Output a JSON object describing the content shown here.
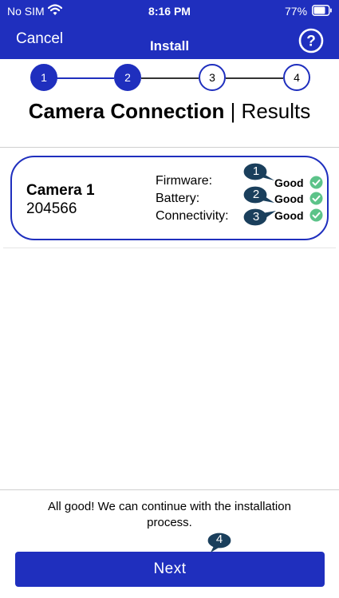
{
  "status_bar": {
    "carrier": "No SIM",
    "time": "8:16 PM",
    "battery": "77%"
  },
  "nav": {
    "cancel": "Cancel",
    "title": "Install"
  },
  "stepper": {
    "steps": [
      "1",
      "2",
      "3",
      "4"
    ],
    "active_step": 2
  },
  "screen": {
    "title_bold": "Camera Connection",
    "separator": " | ",
    "title_rest": "Results"
  },
  "camera": {
    "name": "Camera 1",
    "serial": "204566",
    "metrics": [
      {
        "label": "Firmware:",
        "value": "Good"
      },
      {
        "label": "Battery:",
        "value": "Good"
      },
      {
        "label": "Connectivity:",
        "value": "Good"
      }
    ]
  },
  "footer": {
    "message": "All good! We can continue with the installation process.",
    "next_label": "Next"
  },
  "callouts": [
    "1",
    "2",
    "3",
    "4"
  ],
  "colors": {
    "primary": "#1f2fbe",
    "success": "#5cc389",
    "callout": "#1a3f5c"
  }
}
